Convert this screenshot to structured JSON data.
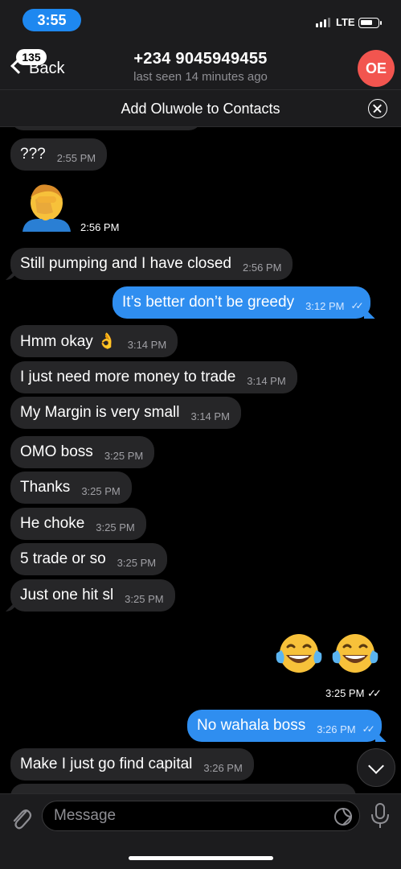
{
  "status_bar": {
    "time": "3:55",
    "network": "LTE"
  },
  "nav": {
    "back_label": "Back",
    "unread_count": "135",
    "title": "+234 9045949455",
    "subtitle": "last seen 14 minutes ago",
    "avatar_initials": "OE"
  },
  "banner": {
    "text": "Add Oluwole to Contacts"
  },
  "messages": [
    {
      "dir": "in",
      "text": "???",
      "time": "2:55 PM"
    },
    {
      "dir": "in",
      "type": "emoji",
      "icon": "facepalm-emoji",
      "time": "2:56 PM"
    },
    {
      "dir": "in",
      "text": "Still pumping and I have closed",
      "time": "2:56 PM"
    },
    {
      "dir": "out",
      "text": "It’s better don’t be greedy",
      "time": "3:12 PM"
    },
    {
      "dir": "in",
      "text": "Hmm okay 👌",
      "time": "3:14 PM"
    },
    {
      "dir": "in",
      "text": "I just need more money to trade",
      "time": "3:14 PM"
    },
    {
      "dir": "in",
      "text": "My Margin is very small",
      "time": "3:14 PM"
    },
    {
      "dir": "in",
      "text": "OMO boss",
      "time": "3:25 PM"
    },
    {
      "dir": "in",
      "text": "Thanks",
      "time": "3:25 PM"
    },
    {
      "dir": "in",
      "text": "He choke",
      "time": "3:25 PM"
    },
    {
      "dir": "in",
      "text": "5 trade or so",
      "time": "3:25 PM"
    },
    {
      "dir": "in",
      "text": "Just one hit sl",
      "time": "3:25 PM"
    },
    {
      "dir": "out",
      "type": "emoji",
      "icon": "laughing-tears-emoji",
      "count": 2,
      "time": "3:25 PM"
    },
    {
      "dir": "out",
      "text": "No wahala boss",
      "time": "3:26 PM"
    },
    {
      "dir": "in",
      "text": "Make I just go find capital",
      "time": "3:26 PM"
    }
  ],
  "input": {
    "placeholder": "Message"
  },
  "icons": {
    "attach": "paperclip-icon",
    "sticker": "sticker-icon",
    "mic": "microphone-icon",
    "scroll": "chevron-down-icon",
    "close": "close-icon",
    "back": "chevron-left-icon"
  },
  "colors": {
    "accent": "#2f8ef0",
    "avatar": "#f2554f",
    "incoming_bubble": "#262628"
  }
}
